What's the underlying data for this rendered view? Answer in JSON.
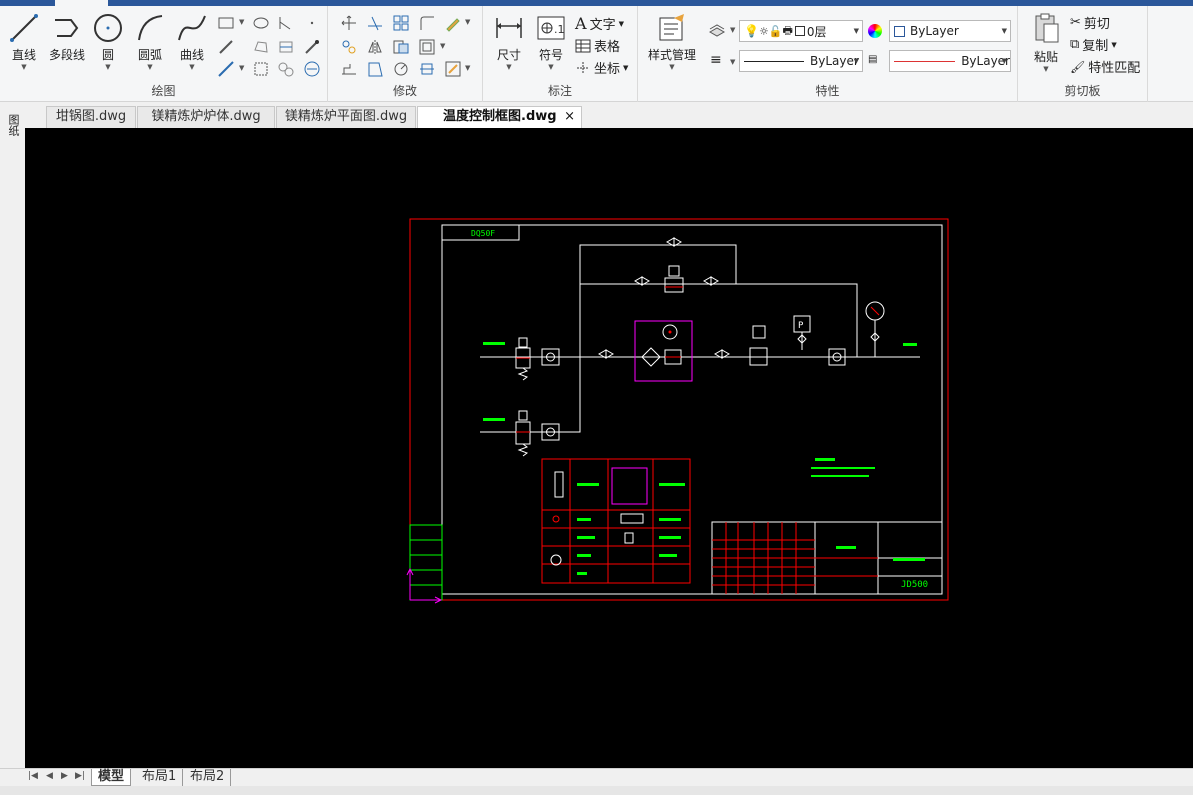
{
  "ribbon": {
    "draw": {
      "title": "绘图",
      "line": "直线",
      "polyline": "多段线",
      "circle": "圆",
      "arc": "圆弧",
      "spline": "曲线"
    },
    "modify": {
      "title": "修改"
    },
    "annotate": {
      "title": "标注",
      "dimension": "尺寸",
      "symbol": "符号",
      "text": "文字",
      "table": "表格",
      "coordinate": "坐标"
    },
    "properties": {
      "title": "特性",
      "style_manager": "样式管理",
      "layer_value": "0层",
      "color_value": "ByLayer",
      "linetype_value": "ByLayer",
      "lineweight_value": "ByLayer"
    },
    "clipboard": {
      "title": "剪切板",
      "paste": "粘贴",
      "cut": "剪切",
      "copy": "复制",
      "match": "特性匹配"
    }
  },
  "file_tabs": [
    {
      "label": "坩锅图.dwg"
    },
    {
      "label": "镁精炼炉炉体.dwg"
    },
    {
      "label": "镁精炼炉平面图.dwg"
    },
    {
      "label": "温度控制框图.dwg"
    }
  ],
  "file_tab_close": "×",
  "sidebar_label": "图纸",
  "layout_tabs": [
    {
      "label": "模型"
    },
    {
      "label": "布局1"
    },
    {
      "label": "布局2"
    }
  ],
  "drawing": {
    "top_box_label": "DQ50F",
    "drawing_no": "JD500",
    "colors": {
      "border": "#ff0000",
      "frame": "#ffffff",
      "text": "#00ff00",
      "magenta": "#ff00ff"
    }
  }
}
